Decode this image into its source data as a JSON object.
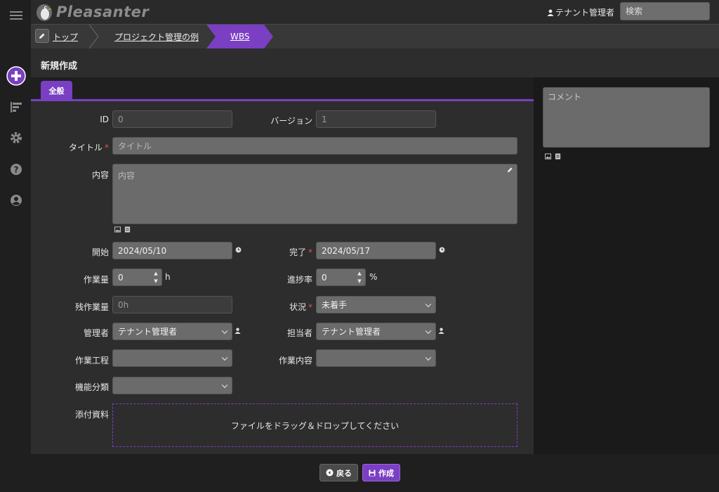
{
  "app": {
    "logo_text": "Pleasanter",
    "user_name": "テナント管理者",
    "search_placeholder": "検索"
  },
  "breadcrumb": [
    {
      "label": "トップ"
    },
    {
      "label": "プロジェクト管理の例"
    },
    {
      "label": "WBS"
    }
  ],
  "page": {
    "title": "新規作成",
    "tab_label": "全般"
  },
  "form": {
    "id_label": "ID",
    "id_value": "0",
    "version_label": "バージョン",
    "version_value": "1",
    "title_label": "タイトル",
    "title_placeholder": "タイトル",
    "body_label": "内容",
    "body_placeholder": "内容",
    "start_label": "開始",
    "start_value": "2024/05/10",
    "end_label": "完了",
    "end_value": "2024/05/17",
    "work_label": "作業量",
    "work_value": "0",
    "work_unit": "h",
    "progress_label": "進捗率",
    "progress_value": "0",
    "progress_unit": "%",
    "remain_label": "残作業量",
    "remain_value": "0h",
    "status_label": "状況",
    "status_value": "未着手",
    "manager_label": "管理者",
    "manager_value": "テナント管理者",
    "owner_label": "担当者",
    "owner_value": "テナント管理者",
    "process_label": "作業工程",
    "process_value": "",
    "content_label": "作業内容",
    "content_value": "",
    "feature_label": "機能分類",
    "feature_value": "",
    "attach_label": "添付資料",
    "attach_drop_text": "ファイルをドラッグ＆ドロップしてください",
    "required_mark": "*"
  },
  "comment": {
    "placeholder": "コメント"
  },
  "footer": {
    "back_label": "戻る",
    "create_label": "作成"
  },
  "colors": {
    "accent": "#7a3fc2",
    "required": "#d9534f"
  }
}
